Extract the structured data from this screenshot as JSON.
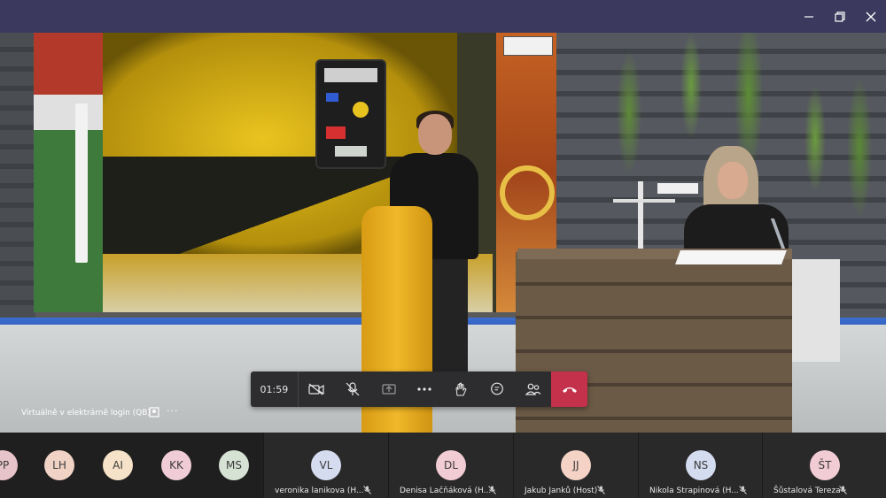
{
  "window": {
    "controls": [
      "minimize-icon",
      "restore-icon",
      "close-icon"
    ],
    "titlebar_color": "#3b3a5e"
  },
  "call": {
    "timer": "01:59",
    "meeting_name": "Virtuálně v elektrárně login (QB)",
    "toolbar": [
      "camera-off-icon",
      "mic-off-icon",
      "share-tray-icon",
      "more-actions-icon",
      "raise-hand-icon",
      "chat-icon",
      "participants-icon",
      "hang-up-icon"
    ],
    "hangup_color": "#c4314b"
  },
  "small_avatars": [
    {
      "initials": "PP",
      "color": "#e7c4c9"
    },
    {
      "initials": "LH",
      "color": "#f1d3c6"
    },
    {
      "initials": "AI",
      "color": "#f6e2c8"
    },
    {
      "initials": "KK",
      "color": "#f0cdd6"
    },
    {
      "initials": "MS",
      "color": "#d6e3d4"
    }
  ],
  "participants": [
    {
      "initials": "VL",
      "name": "veronika lanikova (H...",
      "color": "#d5dcef"
    },
    {
      "initials": "DL",
      "name": "Denisa Lačňáková (H...",
      "color": "#f1ccd4"
    },
    {
      "initials": "JJ",
      "name": "Jakub Janků (Host)",
      "color": "#f4d3c6"
    },
    {
      "initials": "NS",
      "name": "Nikola Strapinová (H...",
      "color": "#d4dcef"
    },
    {
      "initials": "ŠT",
      "name": "Šůstalová Tereza",
      "color": "#f1ccd4"
    }
  ]
}
